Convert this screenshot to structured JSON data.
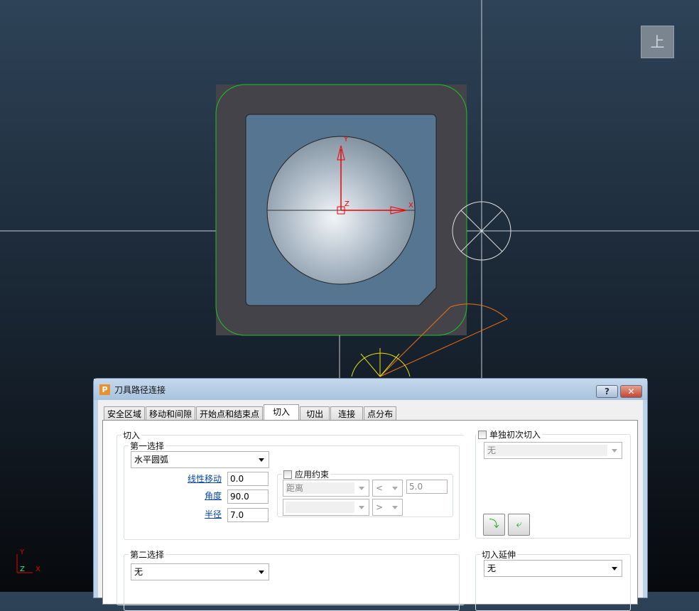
{
  "viewport": {
    "view_label": "上",
    "axis_labels": {
      "x": "X",
      "y": "Y",
      "z": "Z"
    }
  },
  "dialog": {
    "title": "刀具路径连接",
    "app_icon": "P",
    "help_label": "?",
    "close_label": "✕",
    "tabs": [
      {
        "label": "安全区域"
      },
      {
        "label": "移动和间隙"
      },
      {
        "label": "开始点和结束点"
      },
      {
        "label": "切入",
        "active": true
      },
      {
        "label": "切出"
      },
      {
        "label": "连接"
      },
      {
        "label": "点分布"
      }
    ],
    "lead_in": {
      "group_label": "切入",
      "first_choice": {
        "label": "第一选择",
        "value": "水平圆弧",
        "linear_move_label": "线性移动",
        "linear_move": "0.0",
        "angle_label": "角度",
        "angle": "90.0",
        "radius_label": "半径",
        "radius": "7.0",
        "constraint": {
          "label": "应用约束",
          "checked": false,
          "type": "距离",
          "op1": "<",
          "value": "5.0",
          "type2": "",
          "op2": ">"
        }
      },
      "second_choice": {
        "label": "第二选择",
        "value": "无"
      }
    },
    "separate_first": {
      "label": "单独初次切入",
      "checked": false,
      "value": "无"
    },
    "extension": {
      "label": "切入延伸",
      "value": "无"
    }
  }
}
